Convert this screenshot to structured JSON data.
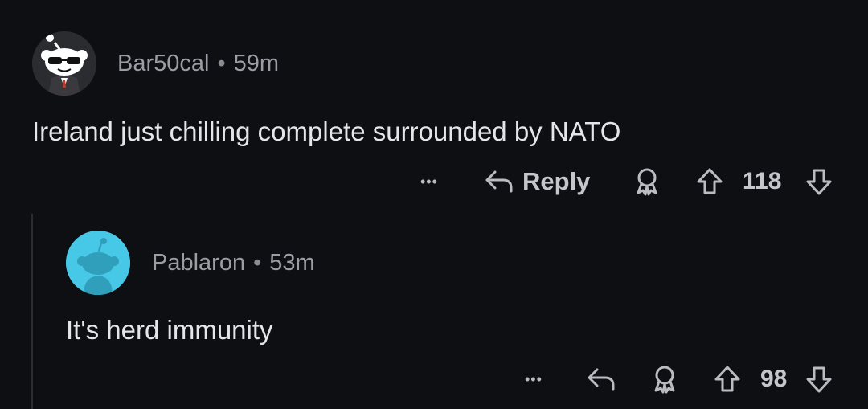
{
  "comments": [
    {
      "username": "Bar50cal",
      "separator": "•",
      "age": "59m",
      "body": "Ireland just chilling complete surrounded by NATO",
      "actions": {
        "more_glyph": "•••",
        "reply_label": "Reply",
        "score": "118"
      },
      "avatar_icon": "snoo-sunglasses-avatar"
    },
    {
      "username": "Pablaron",
      "separator": "•",
      "age": "53m",
      "body": "It's herd immunity",
      "actions": {
        "more_glyph": "•••",
        "score": "98"
      },
      "avatar_icon": "snoo-default-avatar",
      "avatar_color": "#46c8e6"
    }
  ],
  "colors": {
    "background": "#0e0f12",
    "text": "#e4e6e8",
    "meta": "#9a9ea4"
  }
}
